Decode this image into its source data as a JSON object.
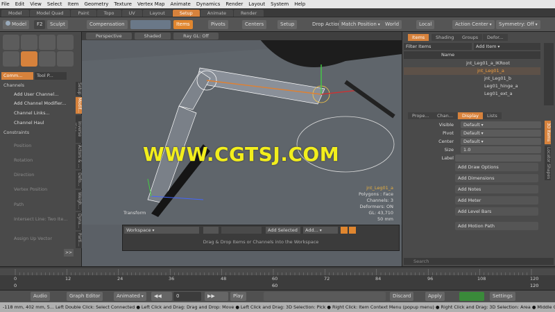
{
  "menu": [
    "File",
    "Edit",
    "View",
    "Select",
    "Item",
    "Geometry",
    "Texture",
    "Vertex Map",
    "Animate",
    "Dynamics",
    "Render",
    "Layout",
    "System",
    "Help"
  ],
  "layout_tabs": [
    "Model",
    "Model Quad",
    "Paint",
    "Topo",
    "UV",
    "Layout",
    "Setup",
    "Animate",
    "Render"
  ],
  "layout_tab_active": "Setup",
  "toolbar": {
    "model": "Model",
    "f2": "F2",
    "sculpt": "Sculpt",
    "compensation": "Compensation",
    "items": "Items",
    "pivots": "Pivots",
    "centers": "Centers",
    "setup": "Setup",
    "drop_action": "Drop Action",
    "match_position": "Match Position",
    "world": "World",
    "local": "Local",
    "action_center": "Action Center",
    "symmetry": "Symmetry: Off"
  },
  "left": {
    "tab1": "Comm...",
    "tab2": "Tool P...",
    "channels_header": "Channels",
    "channels": [
      "Add User Channel...",
      "Add Channel Modifier...",
      "Channel Links...",
      "Channel Haul"
    ],
    "constraints_header": "Constraints",
    "constraints": [
      "Position",
      "Rotation",
      "Direction",
      "Vertex Position",
      "Path",
      "Intersect Line: Two Ite...",
      "Assign Up Vector"
    ],
    "vtabs": [
      "Setup",
      "Modif...",
      "Inverse Kine...",
      "Actors & ...",
      "Defo...",
      "Weigh...",
      "Dyna...",
      "Parti..."
    ],
    "more": ">>"
  },
  "viewport": {
    "view": "Perspective",
    "shading": "Shaded",
    "gl": "Ray GL: Off",
    "watermark": "WWW.CGTSJ.COM",
    "info": [
      "jnt_Leg01_a",
      "Polygons : Face",
      "Channels: 3",
      "Deformers: ON",
      "GL: 43,710",
      "50 mm"
    ],
    "transform_label": "Transform"
  },
  "workspace": {
    "dropdown": "Workspace",
    "add_selected": "Add Selected",
    "add": "Add...",
    "hint": "Drag & Drop Items or Channels into the Workspace"
  },
  "right": {
    "tabs": [
      "Items",
      "Shading",
      "Groups",
      "Defor..."
    ],
    "filter": "Filter Items",
    "add_item": "Add Item",
    "col_name": "Name",
    "tree": [
      "jnt_Leg01_a_IKRoot",
      "jnt_Leg01_a",
      "jnt_Leg01_b",
      "Leg01_hinge_a",
      "Leg01_ext_a"
    ],
    "prop_tabs": [
      "Prope...",
      "Chan...",
      "Display",
      "Lists"
    ],
    "props": [
      {
        "label": "Visible",
        "value": "Default"
      },
      {
        "label": "Pivot",
        "value": "Default"
      },
      {
        "label": "Center",
        "value": "Default"
      },
      {
        "label": "Size",
        "value": "1.0"
      },
      {
        "label": "Label",
        "value": ""
      }
    ],
    "buttons": [
      "Add Draw Options",
      "Add Dimensions",
      "Add Notes",
      "Add Meter",
      "Add Level Bars",
      "Add Motion Path"
    ],
    "side_tabs": [
      "3D Items",
      "Locator Shapes"
    ],
    "search_placeholder": "Search"
  },
  "timeline": {
    "ticks": [
      "0",
      "12",
      "24",
      "36",
      "48",
      "60",
      "72",
      "84",
      "96",
      "108",
      "120"
    ],
    "start": "0",
    "end": "120",
    "current": "0",
    "marker_mid": "60",
    "marker_right": "120"
  },
  "transport": {
    "audio": "Audio",
    "graph_editor": "Graph Editor",
    "animated": "Animated",
    "frame": "0",
    "play": "Play",
    "discard": "Discard",
    "apply": "Apply",
    "settings": "Settings"
  },
  "status": "-118 mm, 402 mm, 5...  Left Double Click: Select Connected ● Left Click and Drag: Drag and Drop: Move ● Left Click and Drag: 3D Selection: Pick ● Right Click: Item Context Menu (popup menu) ● Right Click and Drag: 3D Selection: Area ● Middle Click: Create"
}
